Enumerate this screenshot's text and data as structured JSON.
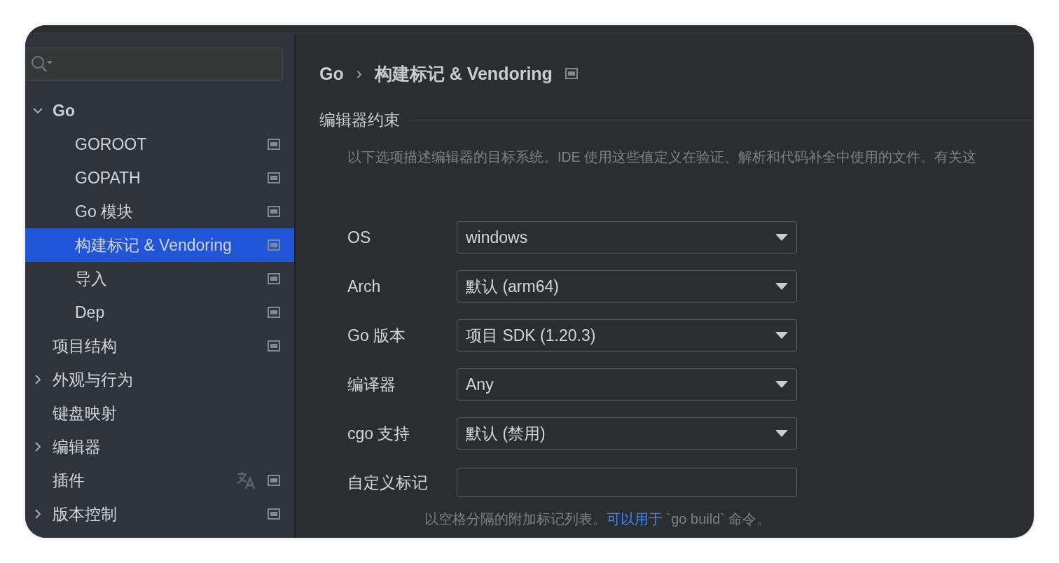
{
  "sidebar": {
    "items": [
      {
        "label": "Go",
        "expanded": true,
        "selected": false,
        "pinned": false,
        "translation": false,
        "children": [
          {
            "label": "GOROOT",
            "selected": false,
            "pinned": true,
            "translation": false
          },
          {
            "label": "GOPATH",
            "selected": false,
            "pinned": true,
            "translation": false
          },
          {
            "label": "Go 模块",
            "selected": false,
            "pinned": true,
            "translation": false
          },
          {
            "label": "构建标记 & Vendoring",
            "selected": true,
            "pinned": true,
            "translation": false
          },
          {
            "label": "导入",
            "selected": false,
            "pinned": true,
            "translation": false
          },
          {
            "label": "Dep",
            "selected": false,
            "pinned": true,
            "translation": false
          }
        ]
      },
      {
        "label": "项目结构",
        "selected": false,
        "pinned": true,
        "translation": false
      },
      {
        "label": "外观与行为",
        "expanded": false,
        "selected": false,
        "pinned": false,
        "translation": false
      },
      {
        "label": "键盘映射",
        "selected": false,
        "pinned": false,
        "translation": false
      },
      {
        "label": "编辑器",
        "expanded": false,
        "selected": false,
        "pinned": false,
        "translation": false
      },
      {
        "label": "插件",
        "selected": false,
        "pinned": true,
        "translation": true
      },
      {
        "label": "版本控制",
        "expanded": false,
        "selected": false,
        "pinned": true,
        "translation": false
      }
    ]
  },
  "breadcrumb": {
    "items": [
      "Go",
      "构建标记 & Vendoring"
    ],
    "separator": "›",
    "pinned": true
  },
  "section": {
    "title": "编辑器约束",
    "description": "以下选项描述编辑器的目标系统。IDE 使用这些值定义在验证、解析和代码补全中使用的文件。有关这"
  },
  "form": [
    {
      "kind": "dropdown",
      "label": "OS",
      "value": "windows"
    },
    {
      "kind": "dropdown",
      "label": "Arch",
      "value": "默认 (arm64)"
    },
    {
      "kind": "dropdown",
      "label": "Go 版本",
      "value": "项目 SDK (1.20.3)"
    },
    {
      "kind": "dropdown",
      "label": "编译器",
      "value": "Any"
    },
    {
      "kind": "dropdown",
      "label": "cgo 支持",
      "value": "默认 (禁用)"
    },
    {
      "kind": "text",
      "label": "自定义标记"
    }
  ],
  "hint": {
    "before": "以空格分隔的附加标记列表。",
    "link": "可以用于",
    "after": "`go build` 命令。"
  }
}
